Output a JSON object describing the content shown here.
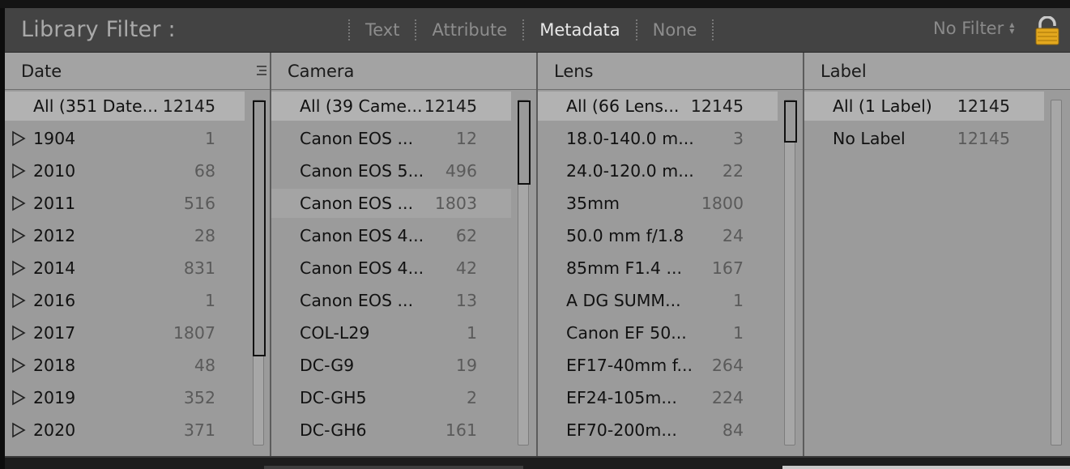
{
  "header": {
    "title": "Library Filter :",
    "tabs": [
      {
        "label": "Text",
        "active": false
      },
      {
        "label": "Attribute",
        "active": false
      },
      {
        "label": "Metadata",
        "active": true
      },
      {
        "label": "None",
        "active": false
      }
    ],
    "preset": "No Filter",
    "lock_icon": "padlock-icon",
    "lock_color": "#e3a81e"
  },
  "columns": [
    {
      "title": "Date",
      "rows": [
        {
          "label": "All (351 Date...",
          "count": "12145",
          "expandable": false
        },
        {
          "label": "1904",
          "count": "1",
          "expandable": true
        },
        {
          "label": "2010",
          "count": "68",
          "expandable": true
        },
        {
          "label": "2011",
          "count": "516",
          "expandable": true
        },
        {
          "label": "2012",
          "count": "28",
          "expandable": true
        },
        {
          "label": "2014",
          "count": "831",
          "expandable": true
        },
        {
          "label": "2016",
          "count": "1",
          "expandable": true
        },
        {
          "label": "2017",
          "count": "1807",
          "expandable": true
        },
        {
          "label": "2018",
          "count": "48",
          "expandable": true
        },
        {
          "label": "2019",
          "count": "352",
          "expandable": true
        },
        {
          "label": "2020",
          "count": "371",
          "expandable": true
        }
      ]
    },
    {
      "title": "Camera",
      "rows": [
        {
          "label": "All (39 Came...",
          "count": "12145"
        },
        {
          "label": "Canon  EOS ...",
          "count": "12"
        },
        {
          "label": "Canon EOS 5...",
          "count": "496"
        },
        {
          "label": "Canon EOS ...",
          "count": "1803"
        },
        {
          "label": "Canon EOS 4...",
          "count": "62"
        },
        {
          "label": "Canon EOS 4...",
          "count": "42"
        },
        {
          "label": "Canon EOS ...",
          "count": "13"
        },
        {
          "label": "COL-L29",
          "count": "1"
        },
        {
          "label": "DC-G9",
          "count": "19"
        },
        {
          "label": "DC-GH5",
          "count": "2"
        },
        {
          "label": "DC-GH6",
          "count": "161"
        }
      ]
    },
    {
      "title": "Lens",
      "rows": [
        {
          "label": "All (66 Lens...",
          "count": "12145"
        },
        {
          "label": "18.0-140.0 m...",
          "count": "3"
        },
        {
          "label": "24.0-120.0 m...",
          "count": "22"
        },
        {
          "label": "35mm",
          "count": "1800"
        },
        {
          "label": "50.0 mm f/1.8",
          "count": "24"
        },
        {
          "label": "85mm F1.4 ...",
          "count": "167"
        },
        {
          "label": "A DG SUMM...",
          "count": "1"
        },
        {
          "label": "Canon EF 50...",
          "count": "1"
        },
        {
          "label": "EF17-40mm f...",
          "count": "264"
        },
        {
          "label": "EF24-105m...",
          "count": "224"
        },
        {
          "label": "EF70-200m...",
          "count": "84"
        }
      ]
    },
    {
      "title": "Label",
      "rows": [
        {
          "label": "All (1 Label)",
          "count": "12145"
        },
        {
          "label": "No Label",
          "count": "12145"
        }
      ]
    }
  ]
}
